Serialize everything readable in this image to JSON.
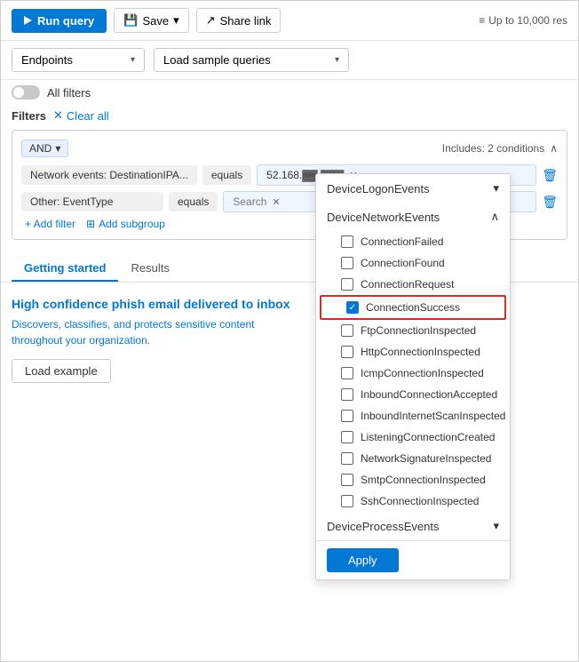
{
  "toolbar": {
    "run_label": "Run query",
    "save_label": "Save",
    "share_label": "Share link",
    "results_limit": "Up to 10,000 res"
  },
  "dropdowns": {
    "table_select": "Endpoints",
    "sample_queries": "Load sample queries"
  },
  "toggle": {
    "label": "All filters"
  },
  "filters": {
    "label": "Filters",
    "clear_label": "Clear all",
    "and_badge": "AND",
    "includes_label": "Includes: 2 conditions",
    "row1": {
      "field": "Network events: DestinationIPA...",
      "operator": "equals",
      "value": "52.168.▓▓.▓▓▓"
    },
    "row2": {
      "field": "Other: EventType",
      "operator": "equals",
      "value": "Search"
    },
    "add_filter": "+ Add filter",
    "add_subgroup": "Add subgroup"
  },
  "tabs": {
    "getting_started": "Getting started",
    "results": "Results"
  },
  "card": {
    "title": "High confidence phish email delivered to inbox",
    "description": "Discovers, classifies, and protects sensitive content throughout your organization.",
    "load_example": "Load example"
  },
  "dropdown_menu": {
    "groups": [
      {
        "name": "DeviceLogonEvents",
        "expanded": false
      },
      {
        "name": "DeviceNetworkEvents",
        "expanded": true,
        "items": [
          {
            "label": "ConnectionFailed",
            "checked": false
          },
          {
            "label": "ConnectionFound",
            "checked": false
          },
          {
            "label": "ConnectionRequest",
            "checked": false
          },
          {
            "label": "ConnectionSuccess",
            "checked": true,
            "highlighted": true
          },
          {
            "label": "FtpConnectionInspected",
            "checked": false
          },
          {
            "label": "HttpConnectionInspected",
            "checked": false
          },
          {
            "label": "IcmpConnectionInspected",
            "checked": false
          },
          {
            "label": "InboundConnectionAccepted",
            "checked": false
          },
          {
            "label": "InboundInternetScanInspected",
            "checked": false
          },
          {
            "label": "ListeningConnectionCreated",
            "checked": false
          },
          {
            "label": "NetworkSignatureInspected",
            "checked": false
          },
          {
            "label": "SmtpConnectionInspected",
            "checked": false
          },
          {
            "label": "SshConnectionInspected",
            "checked": false
          }
        ]
      },
      {
        "name": "DeviceProcessEvents",
        "expanded": false
      }
    ],
    "apply_label": "Apply"
  }
}
